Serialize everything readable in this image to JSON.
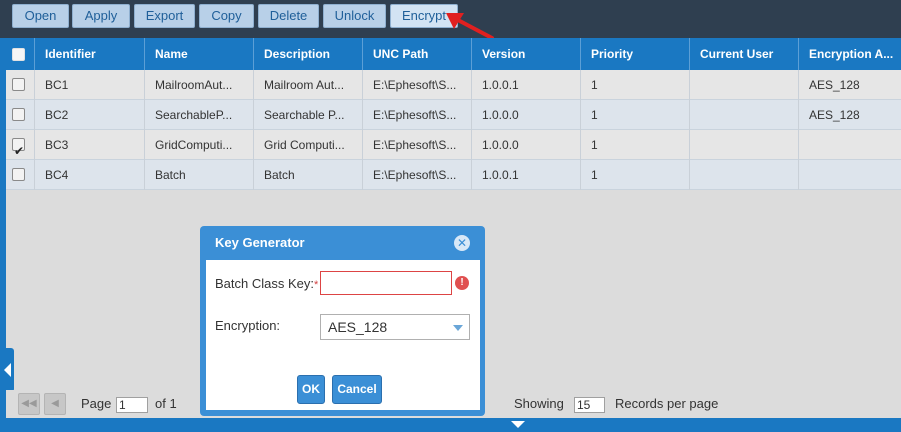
{
  "toolbar": {
    "buttons": [
      {
        "label": "Open"
      },
      {
        "label": "Apply"
      },
      {
        "label": "Export"
      },
      {
        "label": "Copy"
      },
      {
        "label": "Delete"
      },
      {
        "label": "Unlock"
      },
      {
        "label": "Encrypt"
      }
    ]
  },
  "grid": {
    "columns": [
      "Identifier",
      "Name",
      "Description",
      "UNC Path",
      "Version",
      "Priority",
      "Current User",
      "Encryption A..."
    ],
    "rows": [
      {
        "checked": false,
        "identifier": "BC1",
        "name": "MailroomAut...",
        "description": "Mailroom Aut...",
        "unc_path": "E:\\Ephesoft\\S...",
        "version": "1.0.0.1",
        "priority": "1",
        "current_user": "",
        "encryption": "AES_128"
      },
      {
        "checked": false,
        "identifier": "BC2",
        "name": "SearchableP...",
        "description": "Searchable P...",
        "unc_path": "E:\\Ephesoft\\S...",
        "version": "1.0.0.0",
        "priority": "1",
        "current_user": "",
        "encryption": "AES_128"
      },
      {
        "checked": true,
        "identifier": "BC3",
        "name": "GridComputi...",
        "description": "Grid Computi...",
        "unc_path": "E:\\Ephesoft\\S...",
        "version": "1.0.0.0",
        "priority": "1",
        "current_user": "",
        "encryption": ""
      },
      {
        "checked": false,
        "identifier": "BC4",
        "name": "Batch",
        "description": "Batch",
        "unc_path": "E:\\Ephesoft\\S...",
        "version": "1.0.0.1",
        "priority": "1",
        "current_user": "",
        "encryption": ""
      }
    ]
  },
  "pager": {
    "page_label": "Page",
    "page_value": "1",
    "of_label": "of 1",
    "showing_label": "Showing",
    "per_page_value": "15",
    "records_label": "Records per page"
  },
  "dialog": {
    "title": "Key Generator",
    "key_label": "Batch Class Key:",
    "required_mark": "*",
    "key_value": "",
    "error_icon": "exclamation-icon",
    "encryption_label": "Encryption:",
    "encryption_value": "AES_128",
    "ok_label": "OK",
    "cancel_label": "Cancel"
  },
  "colors": {
    "toolbar_bg": "#2f3f50",
    "header_bg": "#1a78c2",
    "dialog_bg": "#3b8fd6",
    "annotation_arrow": "#e02020"
  }
}
